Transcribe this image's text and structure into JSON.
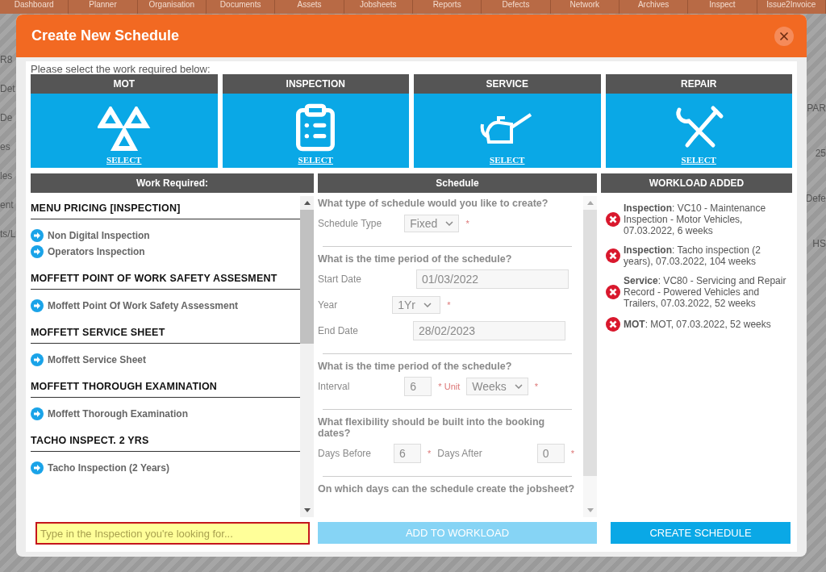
{
  "background": {
    "nav": [
      "Dashboard",
      "Planner",
      "Organisation",
      "Documents",
      "Assets",
      "Jobsheets",
      "Reports",
      "Defects",
      "Network",
      "Archives",
      "Inspect",
      "Issue2Invoice"
    ],
    "left_fragments": [
      "R8",
      "Det",
      "De",
      "es",
      "les",
      "ent",
      "ts/L"
    ],
    "right_fragments": [
      "PAR",
      "25",
      "Defe",
      "HS"
    ]
  },
  "modal": {
    "title": "Create New Schedule",
    "intro": "Please select the work required below:",
    "work_types": [
      {
        "label": "MOT",
        "action": "SELECT"
      },
      {
        "label": "INSPECTION",
        "action": "SELECT"
      },
      {
        "label": "SERVICE",
        "action": "SELECT"
      },
      {
        "label": "REPAIR",
        "action": "SELECT"
      }
    ],
    "work_required": {
      "title": "Work Required:",
      "groups": [
        {
          "heading": "MENU PRICING [INSPECTION]",
          "items": [
            "Non Digital Inspection",
            "Operators Inspection"
          ]
        },
        {
          "heading": "MOFFETT POINT OF WORK SAFETY ASSESMENT",
          "items": [
            "Moffett Point Of Work Safety Assessment"
          ]
        },
        {
          "heading": "MOFFETT SERVICE SHEET",
          "items": [
            "Moffett Service Sheet"
          ]
        },
        {
          "heading": "MOFFETT THOROUGH EXAMINATION",
          "items": [
            "Moffett Thorough Examination"
          ]
        },
        {
          "heading": "TACHO INSPECT. 2 YRS",
          "items": [
            "Tacho Inspection (2 Years)"
          ]
        }
      ]
    },
    "search": {
      "placeholder": "Type in the Inspection you're looking for..."
    },
    "schedule": {
      "title": "Schedule",
      "disabled": true,
      "sections": [
        {
          "question": "What type of schedule would you like to create?",
          "rows": [
            [
              {
                "kind": "label",
                "text": "Schedule Type"
              },
              {
                "kind": "select",
                "text": "Fixed"
              },
              {
                "kind": "mark",
                "text": "*"
              }
            ]
          ]
        },
        {
          "question": "What is the time period of the schedule?",
          "rows": [
            [
              {
                "kind": "label",
                "text": "Start Date"
              },
              {
                "kind": "date",
                "text": "01/03/2022"
              }
            ],
            [
              {
                "kind": "label",
                "text": "Year"
              },
              {
                "kind": "select",
                "text": "1Yr"
              },
              {
                "kind": "mark",
                "text": "*"
              }
            ],
            [
              {
                "kind": "label",
                "text": "End Date"
              },
              {
                "kind": "date",
                "text": "28/02/2023"
              }
            ]
          ]
        },
        {
          "question": "What is the time period of the schedule?",
          "rows": [
            [
              {
                "kind": "label",
                "text": "Interval"
              },
              {
                "kind": "number",
                "text": "6"
              },
              {
                "kind": "mark",
                "text": "* Unit"
              },
              {
                "kind": "select",
                "text": "Weeks"
              },
              {
                "kind": "mark",
                "text": "*"
              }
            ]
          ]
        },
        {
          "question": "What flexibility should be built into the booking dates?",
          "rows": [
            [
              {
                "kind": "label",
                "text": "Days Before"
              },
              {
                "kind": "number",
                "text": "6"
              },
              {
                "kind": "mark",
                "text": "*"
              },
              {
                "kind": "label",
                "text": "Days After"
              },
              {
                "kind": "number",
                "text": "0"
              },
              {
                "kind": "mark",
                "text": "*"
              }
            ]
          ]
        },
        {
          "question": "On which days can the schedule create the jobsheet?"
        }
      ]
    },
    "workload": {
      "title": "WORKLOAD ADDED",
      "items": [
        "**Inspection**: VC10 - Maintenance Inspection - Motor Vehicles, 07.03.2022, 6 weeks",
        "**Inspection**: Tacho inspection (2 years), 07.03.2022, 104 weeks",
        "**Service**: VC80 - Servicing and Repair Record - Powered Vehicles and Trailers, 07.03.2022, 52 weeks",
        "**MOT**: MOT, 07.03.2022, 52 weeks"
      ]
    },
    "buttons": [
      {
        "label": "ADD TO WORKLOAD",
        "disabled": true
      },
      {
        "label": "CREATE SCHEDULE",
        "disabled": false
      }
    ]
  }
}
